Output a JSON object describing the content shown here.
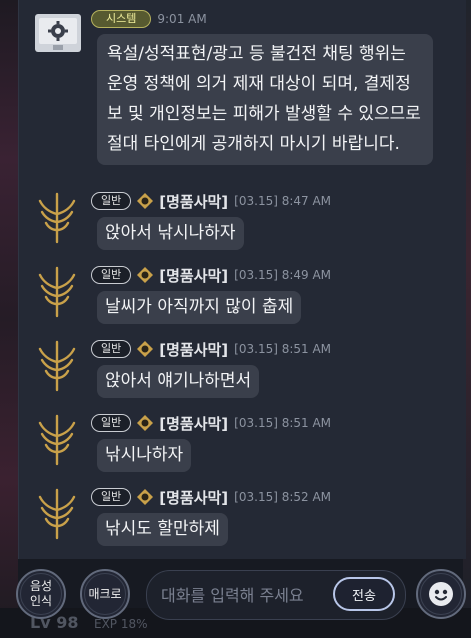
{
  "background": {
    "level_label": "Lv 98",
    "exp_label": "EXP 18%"
  },
  "colors": {
    "panel_bg": "#242935",
    "bubble_bg": "#3a3f4b",
    "system_chip": "#575a30",
    "gold_emblem": "#c9a14a"
  },
  "system_message": {
    "tag": "시스템",
    "time": "9:01 AM",
    "text": "욕설/성적표현/광고 등 불건전 채팅 행위는 운영 정책에 의거 제재 대상이 되며, 결제정보 및 개인정보는 피해가 발생할 수 있으므로 절대 타인에게 공개하지 마시기 바랍니다.",
    "icon": "monitor-gear-icon"
  },
  "messages": [
    {
      "channel": "일반",
      "name": "[명품사막]",
      "time": "[03.15] 8:47 AM",
      "text": "앉아서 낚시나하자"
    },
    {
      "channel": "일반",
      "name": "[명품사막]",
      "time": "[03.15] 8:49 AM",
      "text": "날씨가 아직까지 많이 춥제"
    },
    {
      "channel": "일반",
      "name": "[명품사막]",
      "time": "[03.15] 8:51 AM",
      "text": "앉아서 얘기나하면서"
    },
    {
      "channel": "일반",
      "name": "[명품사막]",
      "time": "[03.15] 8:51 AM",
      "text": "낚시나하자"
    },
    {
      "channel": "일반",
      "name": "[명품사막]",
      "time": "[03.15] 8:52 AM",
      "text": "낚시도 할만하제"
    }
  ],
  "input_bar": {
    "voice_label_line1": "음성",
    "voice_label_line2": "인식",
    "macro_label": "매크로",
    "placeholder": "대화를 입력해 주세요",
    "send_label": "전송",
    "emoji_icon": "emoji-face-icon"
  }
}
